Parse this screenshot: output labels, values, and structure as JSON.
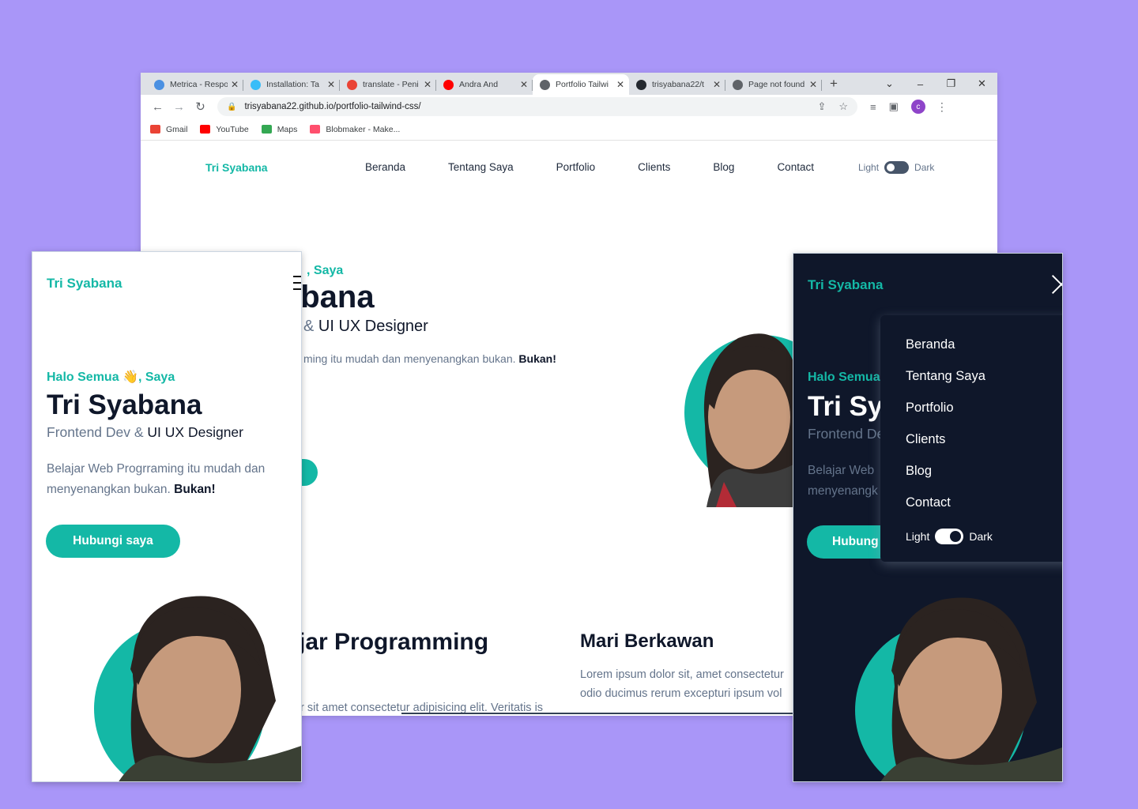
{
  "browser": {
    "tabs": [
      {
        "title": "Metrica - Respo",
        "favicon_color": "#4a90e2"
      },
      {
        "title": "Installation: Ta",
        "favicon_color": "#38bdf8"
      },
      {
        "title": "translate - Peni",
        "favicon_color": "#ea4335"
      },
      {
        "title": "Andra And",
        "favicon_color": "#ff0000"
      },
      {
        "title": "Portfolio Tailwi",
        "favicon_color": "#5f6368"
      },
      {
        "title": "trisyabana22/t",
        "favicon_color": "#24292f"
      },
      {
        "title": "Page not found",
        "favicon_color": "#5f6368"
      }
    ],
    "active_tab_index": 4,
    "new_tab": "+",
    "window_controls": {
      "chevron": "⌄",
      "minimize": "–",
      "restore": "❐",
      "close": "✕"
    },
    "url": "trisyabana22.github.io/portfolio-tailwind-css/",
    "profile_initial": "c",
    "bookmarks": [
      {
        "label": "Gmail",
        "icon_color": "#ea4335"
      },
      {
        "label": "YouTube",
        "icon_color": "#ff0000"
      },
      {
        "label": "Maps",
        "icon_color": "#34a853"
      },
      {
        "label": "Blobmaker - Make...",
        "icon_color": "#ff4f6d"
      }
    ]
  },
  "site": {
    "logo": "Tri Syabana",
    "nav": [
      "Beranda",
      "Tentang Saya",
      "Portfolio",
      "Clients",
      "Blog",
      "Contact"
    ],
    "theme_light": "Light",
    "theme_dark": "Dark",
    "desktop_greeting": ", Saya",
    "desktop_name": "abana",
    "desktop_role_amp": "& ",
    "desktop_role_rest": "UI UX Designer",
    "desktop_desc": "ming itu mudah dan menyenangkan bukan. ",
    "desktop_desc_bold": "Bukan!",
    "section1_title": "jar Programming",
    "section1_text": "r sit amet consectetur adipisicing elit. Veritatis is laudantium suscipit dolorem quo!",
    "section2_title": "Mari Berkawan",
    "section2_text_line1": "Lorem ipsum dolor sit, amet consectetur",
    "section2_text_line2": "odio ducimus rerum excepturi ipsum vol",
    "social_icons": [
      "youtube-icon",
      "instagram-icon",
      "twitter-icon"
    ]
  },
  "mobile": {
    "logo": "Tri Syabana",
    "greeting": "Halo Semua 👋, Saya",
    "name": "Tri Syabana",
    "role_prefix": "Frontend Dev & ",
    "role_highlight": "UI UX Designer",
    "desc": "Belajar Web Progrraming itu mudah dan menyenangkan bukan. ",
    "desc_bold": "Bukan!",
    "button": "Hubungi saya"
  },
  "mobile_dark": {
    "logo": "Tri Syabana",
    "greeting": "Halo Semua",
    "name": "Tri Sy",
    "role": "Frontend De",
    "desc_line1": "Belajar Web",
    "desc_line2": "menyenangk",
    "button": "Hubung",
    "menu": [
      "Beranda",
      "Tentang Saya",
      "Portfolio",
      "Clients",
      "Blog",
      "Contact"
    ],
    "theme_light": "Light",
    "theme_dark": "Dark"
  },
  "colors": {
    "accent": "#14b8a6",
    "dark_bg": "#0f172a",
    "backdrop": "#a996f8"
  }
}
